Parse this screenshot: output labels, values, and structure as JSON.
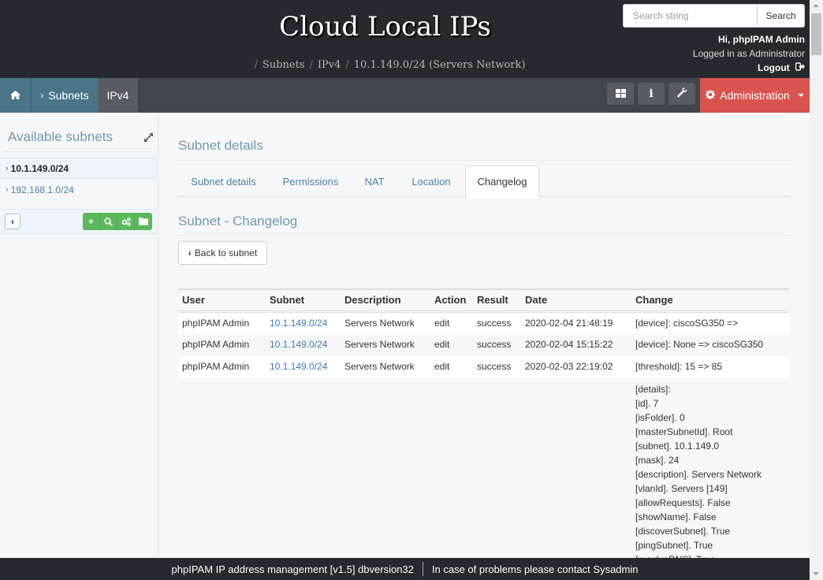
{
  "header": {
    "site_title": "Cloud Local IPs",
    "breadcrumb": [
      "Subnets",
      "IPv4",
      "10.1.149.0/24 (Servers Network)"
    ],
    "search": {
      "placeholder": "Search string",
      "button_label": "Search"
    },
    "user": {
      "greeting": "Hi, phpIPAM Admin",
      "logged_in_as": "Logged in as  Administrator",
      "logout_label": "Logout"
    }
  },
  "nav": {
    "home_icon": "home-icon",
    "subnets_label": "Subnets",
    "ipv4_label": "IPv4",
    "icon_buttons": [
      "dashboard-icon",
      "info-icon",
      "wrench-icon"
    ],
    "admin_label": "Administration",
    "admin_color": "#d9534f"
  },
  "sidebar": {
    "title": "Available subnets",
    "subnets": [
      {
        "label": "10.1.149.0/24",
        "active": true
      },
      {
        "label": "192.168.1.0/24",
        "active": false
      }
    ],
    "toolbar_icons": [
      "plus-icon",
      "search-icon",
      "cogs-icon",
      "folder-icon"
    ]
  },
  "main": {
    "title": "Subnet details",
    "tabs": [
      {
        "label": "Subnet details"
      },
      {
        "label": "Permissions"
      },
      {
        "label": "NAT"
      },
      {
        "label": "Location"
      },
      {
        "label": "Changelog",
        "active": true
      }
    ],
    "changelog_title": "Subnet - Changelog",
    "back_button": "Back to subnet",
    "table": {
      "columns": [
        "User",
        "Subnet",
        "Description",
        "Action",
        "Result",
        "Date",
        "Change"
      ],
      "rows": [
        {
          "user": "phpIPAM Admin",
          "subnet": "10.1.149.0/24",
          "description": "Servers Network",
          "action": "edit",
          "result": "success",
          "date": "2020-02-04 21:48:19",
          "change": "[device]: ciscoSG350 =>"
        },
        {
          "user": "phpIPAM Admin",
          "subnet": "10.1.149.0/24",
          "description": "Servers Network",
          "action": "edit",
          "result": "success",
          "date": "2020-02-04 15:15:22",
          "change": "[device]: None => ciscoSG350"
        },
        {
          "user": "phpIPAM Admin",
          "subnet": "10.1.149.0/24",
          "description": "Servers Network",
          "action": "edit",
          "result": "success",
          "date": "2020-02-03 22:19:02",
          "change": "[threshold]: 15 => 85"
        }
      ],
      "detail_lines": [
        "[details]:",
        "[id]. 7",
        "[isFolder]. 0",
        "[masterSubnetId]. Root",
        "[subnet]. 10.1.149.0",
        "[mask]. 24",
        "[description]. Servers Network",
        "[vlanId]. Servers [149]",
        "[allowRequests]. False",
        "[showName]. False",
        "[discoverSubnet]. True",
        "[pingSubnet]. True",
        "[resolveDNS]. True"
      ]
    }
  },
  "footer": {
    "left": "phpIPAM IP address management [v1.5] dbversion32",
    "right": "In case of problems please contact Sysadmin"
  }
}
